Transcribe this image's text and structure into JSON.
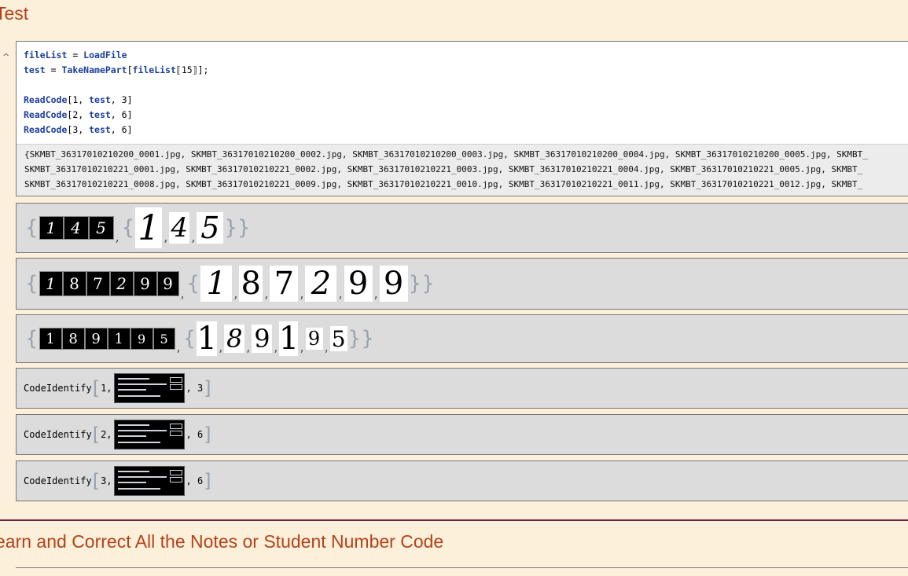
{
  "sections": {
    "title1": "Test",
    "title2": "earn and Correct All the Notes or Student Number Code"
  },
  "input_cell": {
    "line1_var": "fileList",
    "line1_eq": " = ",
    "line1_fn": "LoadFile",
    "line2_var": "test",
    "line2_eq": " = ",
    "line2_fn": "TakeNamePart",
    "line2_open": "[",
    "line2_arg": "fileList",
    "line2_part": "⟦15⟧",
    "line2_close": "];",
    "calls": [
      {
        "fn": "ReadCode",
        "open": "[1, ",
        "arg": "test",
        "close": ", 3]"
      },
      {
        "fn": "ReadCode",
        "open": "[2, ",
        "arg": "test",
        "close": ", 6]"
      },
      {
        "fn": "ReadCode",
        "open": "[3, ",
        "arg": "test",
        "close": ", 6]"
      }
    ]
  },
  "file_list_lines": [
    "{SKMBT_36317010210200_0001.jpg, SKMBT_36317010210200_0002.jpg, SKMBT_36317010210200_0003.jpg, SKMBT_36317010210200_0004.jpg, SKMBT_36317010210200_0005.jpg, SKMBT_",
    " SKMBT_36317010210221_0001.jpg, SKMBT_36317010210221_0002.jpg, SKMBT_36317010210221_0003.jpg, SKMBT_36317010210221_0004.jpg, SKMBT_36317010210221_0005.jpg, SKMBT_",
    " SKMBT_36317010210221_0008.jpg, SKMBT_36317010210221_0009.jpg, SKMBT_36317010210221_0010.jpg, SKMBT_36317010210221_0011.jpg, SKMBT_36317010210221_0012.jpg, SKMBT_"
  ],
  "digit_outputs": [
    {
      "digits": [
        "1",
        "4",
        "5"
      ]
    },
    {
      "digits": [
        "1",
        "8",
        "7",
        "2",
        "9",
        "9"
      ]
    },
    {
      "digits": [
        "1",
        "8",
        "9",
        "1",
        "9",
        "5"
      ]
    }
  ],
  "code_identify": [
    {
      "fn": "CodeIdentify",
      "arg": "1,",
      "last": ", 3"
    },
    {
      "fn": "CodeIdentify",
      "arg": "2,",
      "last": ", 6"
    },
    {
      "fn": "CodeIdentify",
      "arg": "3,",
      "last": ", 6"
    }
  ],
  "colors": {
    "title": "#b3421c",
    "code_blue": "#1d3f9a",
    "background": "#fdf0da",
    "divider": "#6a1f4a"
  }
}
